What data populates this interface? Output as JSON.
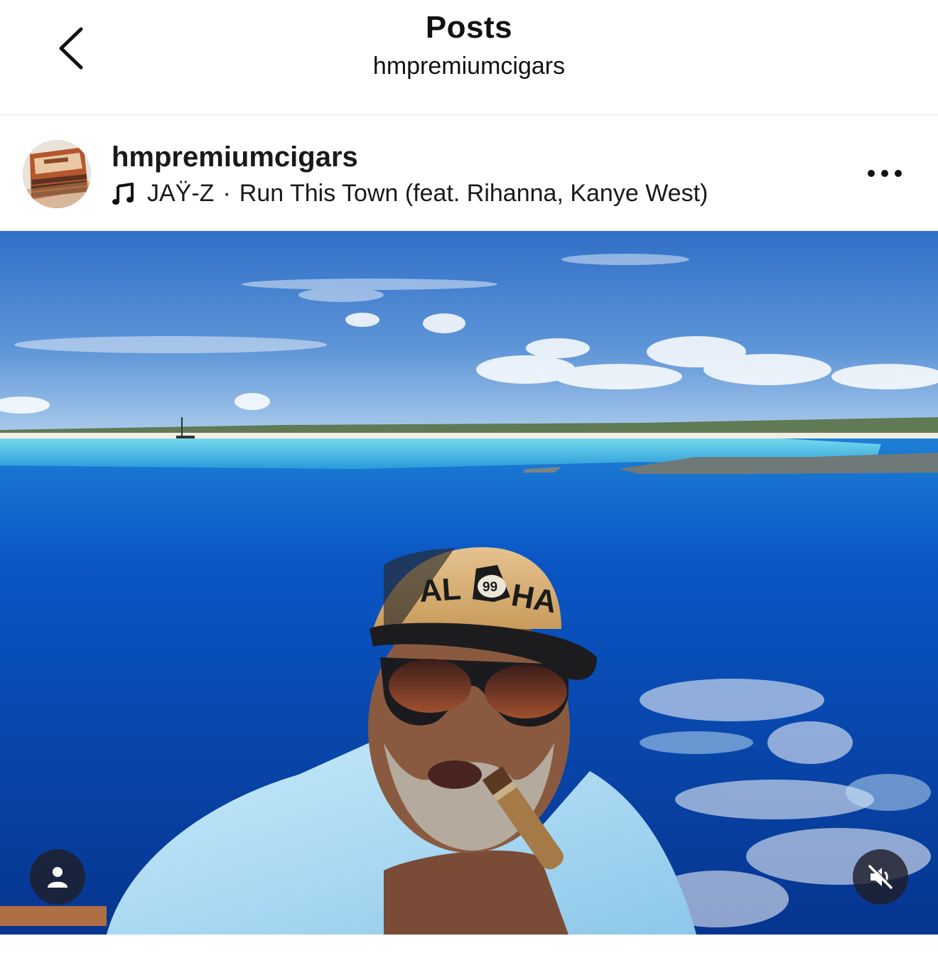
{
  "nav": {
    "title": "Posts",
    "subtitle": "hmpremiumcigars"
  },
  "post": {
    "username": "hmpremiumcigars",
    "music": {
      "artist": "JAŸ-Z",
      "separator": "·",
      "track": "Run This Town (feat. Rihanna, Kanye West)"
    },
    "media": {
      "cap_text_left": "AL",
      "cap_badge": "99",
      "cap_text_right": "HA"
    }
  },
  "icons": {
    "back": "chevron-left-icon",
    "more": "more-horizontal-icon",
    "music": "music-note-icon",
    "tag": "user-tag-icon",
    "mute": "speaker-muted-icon"
  },
  "colors": {
    "sky": "#3f7fd0",
    "ocean": "#0a4fbf",
    "lagoon": "#3fc3dc",
    "shirt": "#a9d8f2",
    "cap": "#d9b37a"
  }
}
